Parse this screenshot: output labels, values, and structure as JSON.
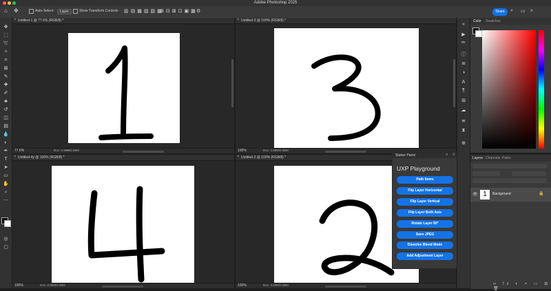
{
  "app": {
    "title": "Adobe Photoshop 2025"
  },
  "options_bar": {
    "auto_select_label": "Auto-Select:",
    "auto_select_value": "Layer",
    "transform_label": "Show Transform Controls",
    "share_label": "Share"
  },
  "documents": [
    {
      "tab": "Untitled-1 @ 77.6% (RGB/8) *",
      "zoom": "77.6%",
      "doc_info": "Doc: 2.86M/2.86M",
      "digit": "1"
    },
    {
      "tab": "Untitled-3 @ 100% (RGB/8) *",
      "zoom": "100%",
      "doc_info": "Doc: 2.86M/2.86M",
      "digit": "3"
    },
    {
      "tab": "Untitled-4y @ 100% (RGB/8) *",
      "zoom": "100%",
      "doc_info": "Doc: 2.86M/2.86M",
      "digit": "4"
    },
    {
      "tab": "Untitled-2 @ 100% (RGB/8) *",
      "zoom": "100%",
      "doc_info": "Doc: 3.00M/2.86M",
      "digit": "2"
    }
  ],
  "color_panel": {
    "tabs": [
      "Color",
      "Swatches"
    ]
  },
  "layers_panel": {
    "tabs": [
      "Layers",
      "Channels",
      "Paths"
    ],
    "layer": {
      "name": "Background",
      "thumb": "1"
    }
  },
  "starter_panel": {
    "title": "Starter Panel",
    "heading": "UXP Playground",
    "buttons": [
      "Path Items",
      "Flip Layer Horizontal",
      "Flip Layer Vertical",
      "Flip Layer Both Axis",
      "Rotate Layer 90°",
      "Save JPEG",
      "Dissolve Blend Mode",
      "Add Adjustment Layer"
    ]
  },
  "colors": {
    "accent": "#1473e6",
    "panel": "#3a3a3a",
    "canvas": "#ffffff"
  }
}
